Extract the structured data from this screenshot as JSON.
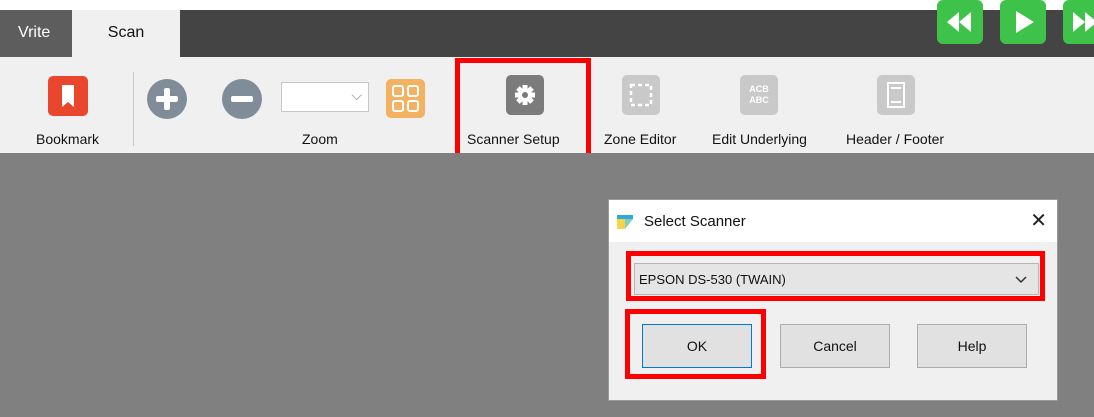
{
  "tabs": [
    {
      "label": "Vrite"
    },
    {
      "label": "Scan"
    }
  ],
  "nav_buttons": [
    "rewind-icon",
    "play-icon",
    "forward-icon"
  ],
  "colors": {
    "nav_green": "#3fc24a",
    "bookmark_red": "#e8472e",
    "zoom_grey": "#808d99",
    "grid_orange": "#f2b261",
    "highlight_red": "#ff0000",
    "canvas_grey": "#808080"
  },
  "ribbon": {
    "bookmark_label": "Bookmark",
    "zoom_label": "Zoom",
    "zoom_value": "",
    "scanner_setup_label": "Scanner Setup",
    "zone_editor_label": "Zone Editor",
    "edit_underlying_label": "Edit Underlying",
    "header_footer_label": "Header / Footer",
    "edit_underlying_icon_text": "ACB ABC"
  },
  "dialog": {
    "title": "Select Scanner",
    "close_glyph": "✕",
    "scanner_value": "EPSON DS-530 (TWAIN)",
    "ok_label": "OK",
    "cancel_label": "Cancel",
    "help_label": "Help"
  }
}
